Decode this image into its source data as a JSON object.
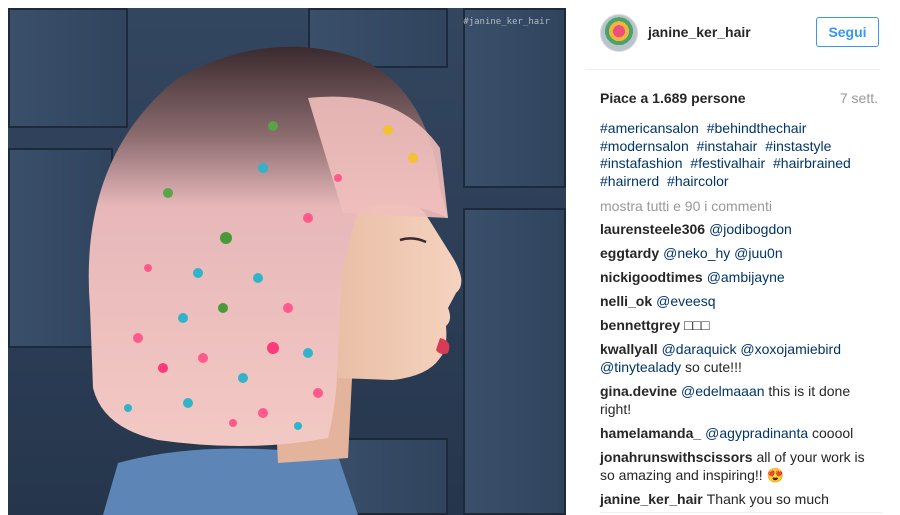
{
  "photo": {
    "watermark": "#janine_ker_hair"
  },
  "post": {
    "username": "janine_ker_hair",
    "follow_label": "Segui",
    "likes_text": "Piace a 1.689 persone",
    "age": "7 sett.",
    "hashtags": [
      "#americansalon",
      "#behindthechair",
      "#modernsalon",
      "#instahair",
      "#instastyle",
      "#instafashion",
      "#festivalhair",
      "#hairbrained",
      "#hairnerd",
      "#haircolor"
    ],
    "show_all_comments": "mostra tutti e 90 i commenti"
  },
  "comments": [
    {
      "user": "laurensteele306",
      "mention": "@jodibogdon",
      "text": ""
    },
    {
      "user": "eggtardy",
      "mention": "@neko_hy @juu0n",
      "text": ""
    },
    {
      "user": "nickigoodtimes",
      "mention": "@ambijayne",
      "text": ""
    },
    {
      "user": "nelli_ok",
      "mention": "@eveesq",
      "text": ""
    },
    {
      "user": "bennettgrey",
      "mention": "",
      "text": "□□□"
    },
    {
      "user": "kwallyall",
      "mention": "@daraquick @xoxojamiebird @tinytealady",
      "text": "so cute!!!"
    },
    {
      "user": "gina.devine",
      "mention": "@edelmaaan",
      "text": "this is it done right!"
    },
    {
      "user": "hamelamanda_",
      "mention": "@agypradinanta",
      "text": "cooool"
    },
    {
      "user": "jonahrunswithscissors",
      "mention": "",
      "text": "all of your work is so amazing and inspiring!! 😍"
    },
    {
      "user": "janine_ker_hair",
      "mention": "",
      "text": "Thank you so much"
    }
  ],
  "colors": {
    "accent": "#3897f0",
    "hashtag": "#003569",
    "muted": "#999999"
  }
}
